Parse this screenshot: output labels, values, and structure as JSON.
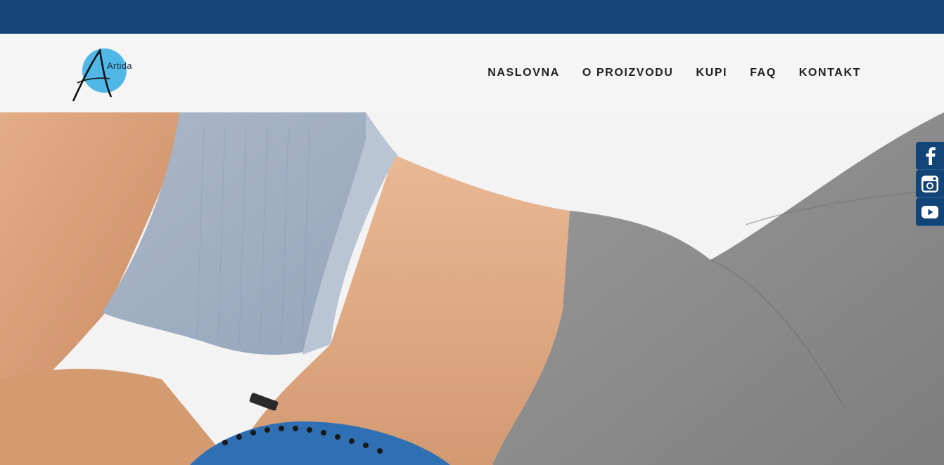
{
  "brand": {
    "logo_text": "Artida",
    "colors": {
      "top_bar": "#134477",
      "logo_circle": "#4fb8e6",
      "social_bg": "#134477"
    }
  },
  "nav": {
    "items": [
      {
        "label": "NASLOVNA"
      },
      {
        "label": "O PROIZVODU"
      },
      {
        "label": "KUPI"
      },
      {
        "label": "FAQ"
      },
      {
        "label": "KONTAKT"
      }
    ]
  },
  "social": {
    "items": [
      {
        "icon": "facebook-icon"
      },
      {
        "icon": "instagram-icon"
      },
      {
        "icon": "youtube-icon"
      }
    ]
  },
  "hero": {
    "image": "woman-in-sportswear-lying-on-massage-mat"
  }
}
